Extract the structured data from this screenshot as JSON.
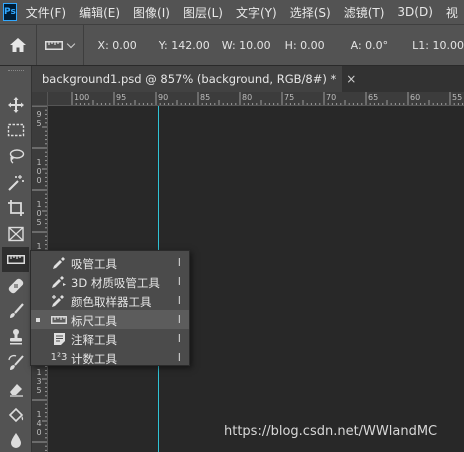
{
  "menubar": {
    "logo": "Ps",
    "items": [
      "文件(F)",
      "编辑(E)",
      "图像(I)",
      "图层(L)",
      "文字(Y)",
      "选择(S)",
      "滤镜(T)",
      "3D(D)",
      "视"
    ]
  },
  "options": {
    "x": "X: 0.00",
    "y": "Y: 142.00",
    "w": "W: 10.00",
    "h": "H: 0.00",
    "a": "A: 0.0°",
    "l1": "L1: 10.00"
  },
  "tab": {
    "title": "background1.psd @ 857% (background, RGB/8#) *",
    "close": "×"
  },
  "ruler": {
    "h_labels": [
      "100",
      "95",
      "90",
      "85",
      "80",
      "75",
      "70",
      "65",
      "60",
      "55"
    ],
    "v_labels": [
      [
        "9",
        "5"
      ],
      [
        "1",
        "0",
        "0"
      ],
      [
        "1",
        "0",
        "5"
      ],
      [
        "1",
        "1",
        "0"
      ],
      [
        "1",
        "3",
        "5"
      ],
      [
        "1",
        "4",
        "0"
      ]
    ]
  },
  "flyout": {
    "items": [
      {
        "label": "吸管工具",
        "key": "I",
        "icon": "eyedropper-icon"
      },
      {
        "label": "3D 材质吸管工具",
        "key": "I",
        "icon": "3d-eyedropper-icon"
      },
      {
        "label": "颜色取样器工具",
        "key": "I",
        "icon": "color-sampler-icon"
      },
      {
        "label": "标尺工具",
        "key": "I",
        "icon": "ruler-icon"
      },
      {
        "label": "注释工具",
        "key": "I",
        "icon": "note-icon"
      },
      {
        "label": "计数工具",
        "key": "I",
        "icon": "count-icon"
      }
    ],
    "count_glyph": "1²3"
  },
  "watermark": "https://blog.csdn.net/WWlandMC",
  "colors": {
    "guide": "#2fc3d6",
    "ps_blue": "#31a8ff"
  }
}
